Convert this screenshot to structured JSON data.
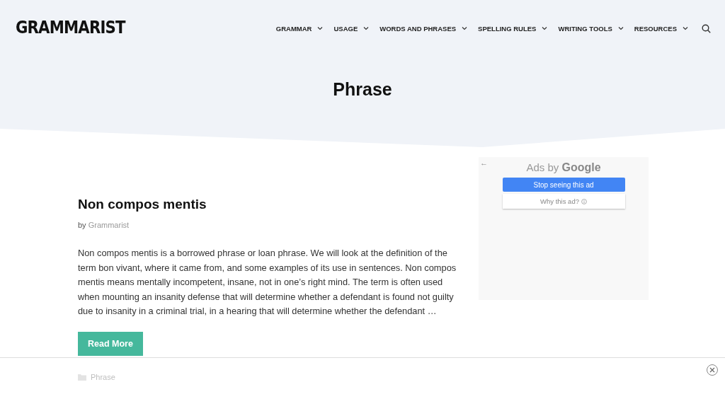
{
  "header": {
    "logo": "GRAMMARIST",
    "nav": [
      {
        "label": "GRAMMAR"
      },
      {
        "label": "USAGE"
      },
      {
        "label": "WORDS AND PHRASES"
      },
      {
        "label": "SPELLING RULES"
      },
      {
        "label": "WRITING TOOLS"
      },
      {
        "label": "RESOURCES"
      }
    ]
  },
  "page_title": "Phrase",
  "post": {
    "title": "Non compos mentis",
    "byline": "by",
    "author": "Grammarist",
    "excerpt": "Non compos mentis is a borrowed phrase or loan phrase. We will look at the definition of the term bon vivant, where it came from, and some examples of its use in sentences. Non compos mentis means mentally incompetent, insane, not in one’s right mind. The term is often used when mounting an insanity defense that will determine whether a defendant is found not guilty due to insanity in a criminal trial, in a hearing that will determine whether the defendant …",
    "button": "Read More",
    "category": "Phrase"
  },
  "ad": {
    "back": "←",
    "heading_prefix": "Ads by",
    "heading_brand": "Google",
    "stop_button": "Stop seeing this ad",
    "why_button": "Why this ad?"
  }
}
